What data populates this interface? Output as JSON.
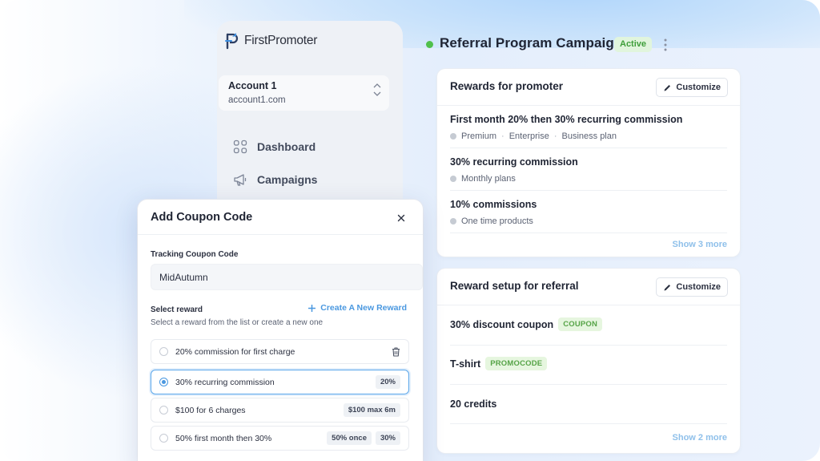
{
  "sidebar": {
    "logo_text": "FirstPromoter",
    "account": {
      "name": "Account 1",
      "domain": "account1.com"
    },
    "nav": [
      {
        "label": "Dashboard",
        "icon": "grid-icon"
      },
      {
        "label": "Campaigns",
        "icon": "megaphone-icon"
      }
    ]
  },
  "header": {
    "title": "Referral Program Campaign",
    "status": "Active"
  },
  "rewards_card": {
    "title": "Rewards for promoter",
    "customize": "Customize",
    "items": [
      {
        "title": "First month 20% then 30% recurring commission",
        "tags": [
          "Premium",
          "Enterprise",
          "Business plan"
        ]
      },
      {
        "title": "30% recurring commission",
        "tags": [
          "Monthly plans"
        ]
      },
      {
        "title": "10% commissions",
        "tags": [
          "One time products"
        ]
      }
    ],
    "show_more": "Show 3 more"
  },
  "setup_card": {
    "title": "Reward setup for referral",
    "customize": "Customize",
    "items": [
      {
        "label": "30% discount coupon",
        "badge": "COUPON"
      },
      {
        "label": "T-shirt",
        "badge": "PROMOCODE"
      },
      {
        "label": "20 credits",
        "badge": ""
      }
    ],
    "show_more": "Show 2 more"
  },
  "modal": {
    "title": "Add Coupon Code",
    "tracking_label": "Tracking Coupon Code",
    "tracking_value": "MidAutumn",
    "select_label": "Select reward",
    "create_link": "Create A New Reward",
    "helper": "Select a reward from the list or create a new one",
    "options": [
      {
        "label": "20% commission for first charge",
        "chips": [],
        "selected": false
      },
      {
        "label": "30% recurring commission",
        "chips": [
          "20%"
        ],
        "selected": true
      },
      {
        "label": "$100 for 6 charges",
        "chips": [
          "$100 max 6m"
        ],
        "selected": false
      },
      {
        "label": "50% first month then 30%",
        "chips": [
          "50% once",
          "30%"
        ],
        "selected": false
      }
    ]
  },
  "colors": {
    "accent": "#4a98e0",
    "status_green": "#50c04c",
    "badge_green_bg": "#e6f6df"
  }
}
